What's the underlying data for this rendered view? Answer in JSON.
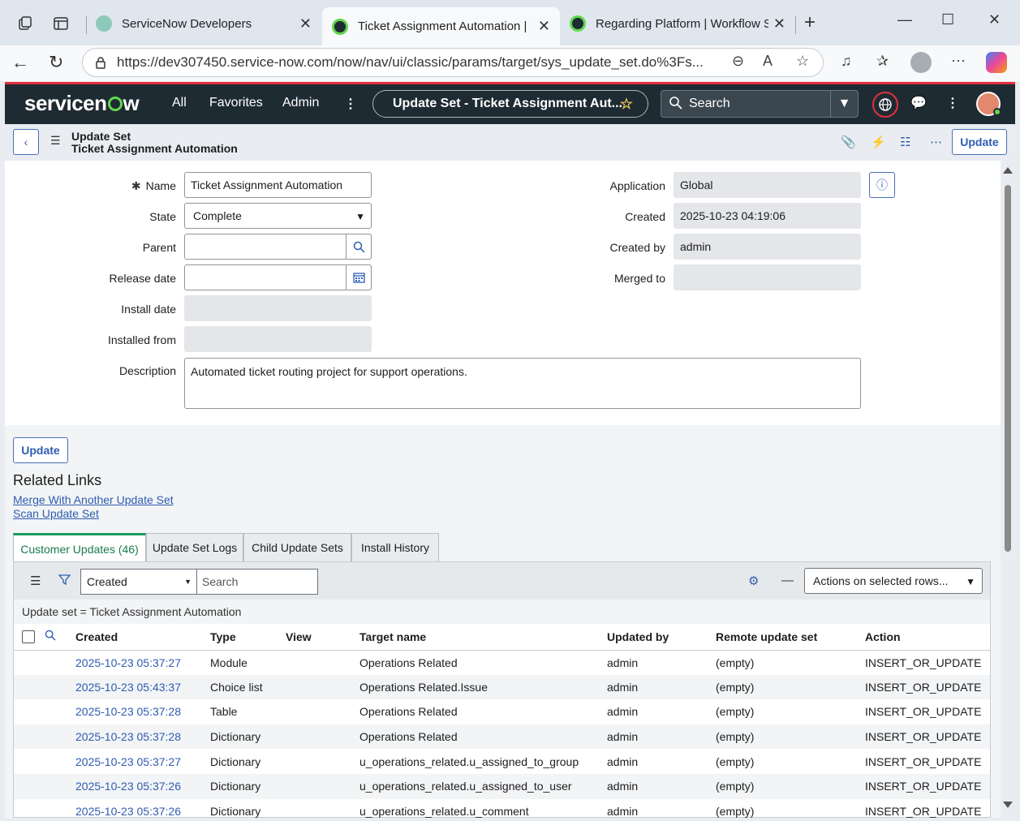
{
  "browser": {
    "tabs": [
      {
        "title": "ServiceNow Developers",
        "active": false
      },
      {
        "title": "Ticket Assignment Automation | ",
        "active": true
      },
      {
        "title": "Regarding Platform | Workflow S",
        "active": false
      }
    ],
    "new_tab": "+",
    "url": "https://dev307450.service-now.com/now/nav/ui/classic/params/target/sys_update_set.do%3Fs..."
  },
  "header": {
    "logo_text_1": "servicen",
    "logo_text_2": "w",
    "menu": [
      "All",
      "Favorites",
      "Admin"
    ],
    "context_pill": "Update Set - Ticket Assignment Aut...",
    "search_placeholder": "Search"
  },
  "form_header": {
    "table_label": "Update Set",
    "record_label": "Ticket Assignment Automation",
    "update_button": "Update"
  },
  "form": {
    "name_label": "Name",
    "name_value": "Ticket Assignment Automation",
    "state_label": "State",
    "state_value": "Complete",
    "parent_label": "Parent",
    "parent_value": "",
    "release_date_label": "Release date",
    "release_date_value": "",
    "install_date_label": "Install date",
    "installed_from_label": "Installed from",
    "description_label": "Description",
    "description_value": "Automated ticket routing project for support operations.",
    "application_label": "Application",
    "application_value": "Global",
    "created_label": "Created",
    "created_value": "2025-10-23 04:19:06",
    "created_by_label": "Created by",
    "created_by_value": "admin",
    "merged_to_label": "Merged to",
    "merged_to_value": ""
  },
  "bottom_update_button": "Update",
  "related_links": {
    "title": "Related Links",
    "links": [
      "Merge With Another Update Set",
      "Scan Update Set"
    ]
  },
  "related_tabs": [
    "Customer Updates (46)",
    "Update Set Logs",
    "Child Update Sets",
    "Install History"
  ],
  "list": {
    "filter_field": "Created",
    "search_placeholder": "Search",
    "actions_label": "Actions on selected rows...",
    "breadcrumb": "Update set = Ticket Assignment Automation",
    "columns": [
      "Created",
      "Type",
      "View",
      "Target name",
      "Updated by",
      "Remote update set",
      "Action"
    ],
    "rows": [
      {
        "created": "2025-10-23 05:37:27",
        "type": "Module",
        "view": "",
        "target": "Operations Related",
        "updated_by": "admin",
        "remote": "(empty)",
        "action": "INSERT_OR_UPDATE"
      },
      {
        "created": "2025-10-23 05:43:37",
        "type": "Choice list",
        "view": "",
        "target": "Operations Related.Issue",
        "updated_by": "admin",
        "remote": "(empty)",
        "action": "INSERT_OR_UPDATE"
      },
      {
        "created": "2025-10-23 05:37:28",
        "type": "Table",
        "view": "",
        "target": "Operations Related",
        "updated_by": "admin",
        "remote": "(empty)",
        "action": "INSERT_OR_UPDATE"
      },
      {
        "created": "2025-10-23 05:37:28",
        "type": "Dictionary",
        "view": "",
        "target": "Operations Related",
        "updated_by": "admin",
        "remote": "(empty)",
        "action": "INSERT_OR_UPDATE"
      },
      {
        "created": "2025-10-23 05:37:27",
        "type": "Dictionary",
        "view": "",
        "target": "u_operations_related.u_assigned_to_group",
        "updated_by": "admin",
        "remote": "(empty)",
        "action": "INSERT_OR_UPDATE"
      },
      {
        "created": "2025-10-23 05:37:26",
        "type": "Dictionary",
        "view": "",
        "target": "u_operations_related.u_assigned_to_user",
        "updated_by": "admin",
        "remote": "(empty)",
        "action": "INSERT_OR_UPDATE"
      },
      {
        "created": "2025-10-23 05:37:26",
        "type": "Dictionary",
        "view": "",
        "target": "u_operations_related.u_comment",
        "updated_by": "admin",
        "remote": "(empty)",
        "action": "INSERT_OR_UPDATE"
      }
    ]
  },
  "colors": {
    "header_bg": "#1f2b33",
    "accent_red": "#e0303c",
    "link_blue": "#2f5cb0",
    "active_tab_green": "#1a9b5c"
  }
}
